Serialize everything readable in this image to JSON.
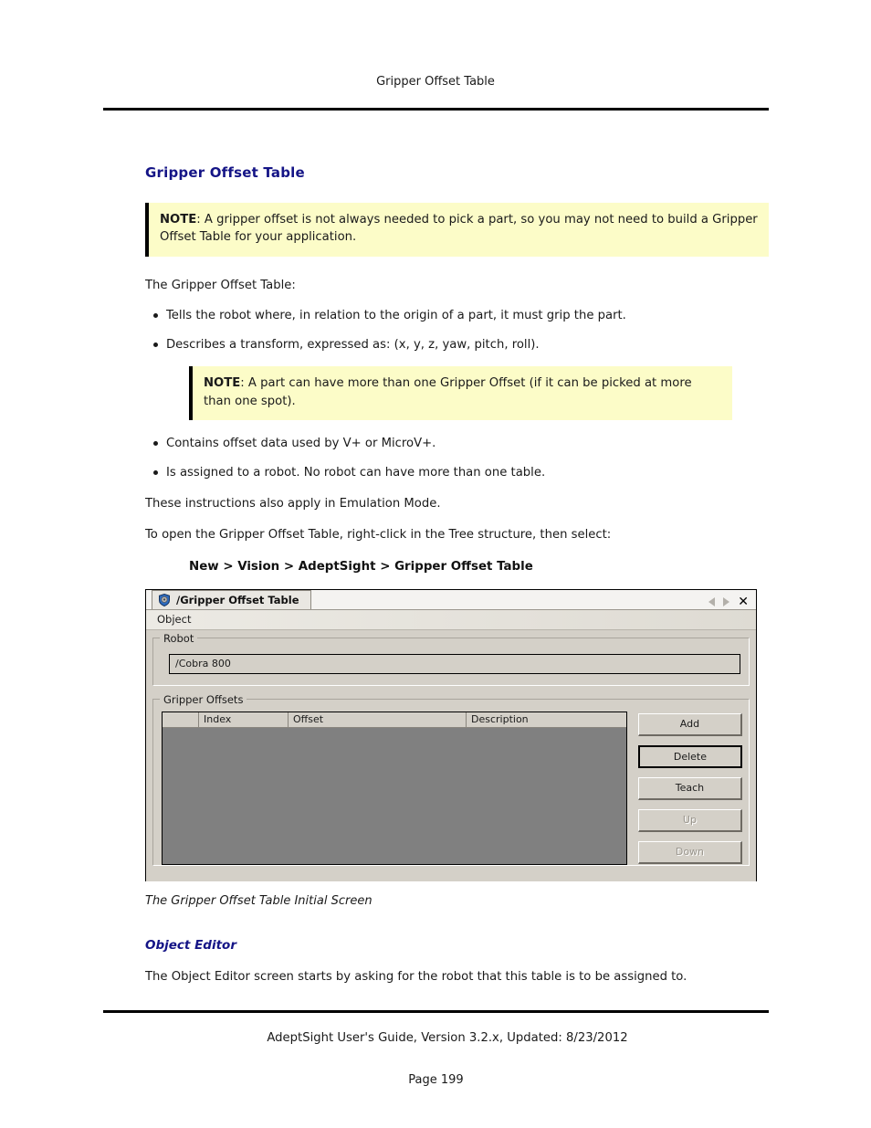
{
  "page": {
    "running_header": "Gripper Offset Table",
    "section_title": "Gripper Offset Table",
    "intro_line": "The Gripper Offset Table:",
    "emulation_line": "These instructions also apply in Emulation Mode.",
    "open_line": "To open the Gripper Offset Table, right-click in the Tree structure, then select:",
    "menu_path": "New > Vision > AdeptSight > Gripper Offset Table",
    "figure_caption": "The Gripper Offset Table Initial Screen",
    "subsection_title": "Object Editor",
    "subsection_body": "The Object Editor screen starts by asking for the robot that this table is to be assigned to.",
    "heading_color": "#141486",
    "note_background": "#fcfcc8"
  },
  "notes": [
    {
      "label": "NOTE",
      "text": ": A gripper offset is not always needed to pick a part, so you may not need to build a Gripper Offset Table for your application."
    },
    {
      "label": "NOTE",
      "text": ": A part can have more than one Gripper Offset (if it can be picked at more than one spot)."
    }
  ],
  "bullets_group_one": [
    "Tells the robot where, in relation to the origin of a part, it must grip the part.",
    "Describes a transform, expressed as: (x, y, z, yaw, pitch, roll)."
  ],
  "bullets_group_two": [
    "Contains offset data used by V+ or MicroV+.",
    "Is assigned to a robot. No robot can have more than one table."
  ],
  "screenshot": {
    "tab": {
      "icon": "shield-gear-icon",
      "label": "/Gripper Offset Table"
    },
    "tab_controls": {
      "prev": "prev-arrow-icon",
      "next": "next-arrow-icon",
      "close": "✕"
    },
    "menubar": {
      "object": "Object"
    },
    "robot_group": {
      "legend": "Robot",
      "field_value": "/Cobra 800"
    },
    "offsets_group": {
      "legend": "Gripper Offsets",
      "columns": [
        "",
        "Index",
        "Offset",
        "Description"
      ],
      "rows": []
    },
    "buttons": [
      {
        "label": "Add",
        "state": "enabled"
      },
      {
        "label": "Delete",
        "state": "focused"
      },
      {
        "label": "Teach",
        "state": "enabled"
      },
      {
        "label": "Up",
        "state": "disabled"
      },
      {
        "label": "Down",
        "state": "disabled"
      }
    ]
  },
  "footer": {
    "guide_line": "AdeptSight User's Guide,  Version 3.2.x, Updated: 8/23/2012",
    "page_number": "Page 199"
  }
}
